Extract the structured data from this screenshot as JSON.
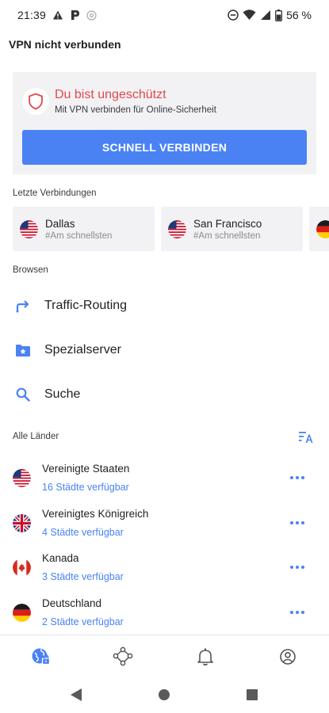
{
  "status_bar": {
    "time": "21:39",
    "battery": "56 %"
  },
  "header": {
    "title": "VPN nicht verbunden"
  },
  "protection": {
    "title": "Du bist ungeschützt",
    "subtitle": "Mit VPN verbinden für Online-Sicherheit",
    "connect_label": "SCHNELL VERBINDEN"
  },
  "recent": {
    "label": "Letzte Verbindungen",
    "items": [
      {
        "city": "Dallas",
        "tag": "#Am schnellsten",
        "flag": "us"
      },
      {
        "city": "San Francisco",
        "tag": "#Am schnellsten",
        "flag": "us"
      },
      {
        "city": "",
        "tag": "",
        "flag": "de"
      }
    ]
  },
  "browse": {
    "label": "Browsen",
    "items": [
      {
        "label": "Traffic-Routing",
        "icon": "routing-arrow-icon"
      },
      {
        "label": "Spezialserver",
        "icon": "star-folder-icon"
      },
      {
        "label": "Suche",
        "icon": "search-icon"
      }
    ]
  },
  "countries": {
    "label": "Alle Länder",
    "items": [
      {
        "name": "Vereinigte Staaten",
        "cities": "16 Städte verfügbar",
        "flag": "us"
      },
      {
        "name": "Vereinigtes Königreich",
        "cities": "4 Städte verfügbar",
        "flag": "gb"
      },
      {
        "name": "Kanada",
        "cities": "3 Städte verfügbar",
        "flag": "ca"
      },
      {
        "name": "Deutschland",
        "cities": "2 Städte verfügbar",
        "flag": "de"
      }
    ]
  },
  "colors": {
    "accent": "#4a82f4",
    "danger": "#e5474d",
    "card_bg": "#f2f2f4"
  },
  "bottom_nav": [
    "globe-lock-icon",
    "network-nodes-icon",
    "bell-icon",
    "account-icon"
  ]
}
